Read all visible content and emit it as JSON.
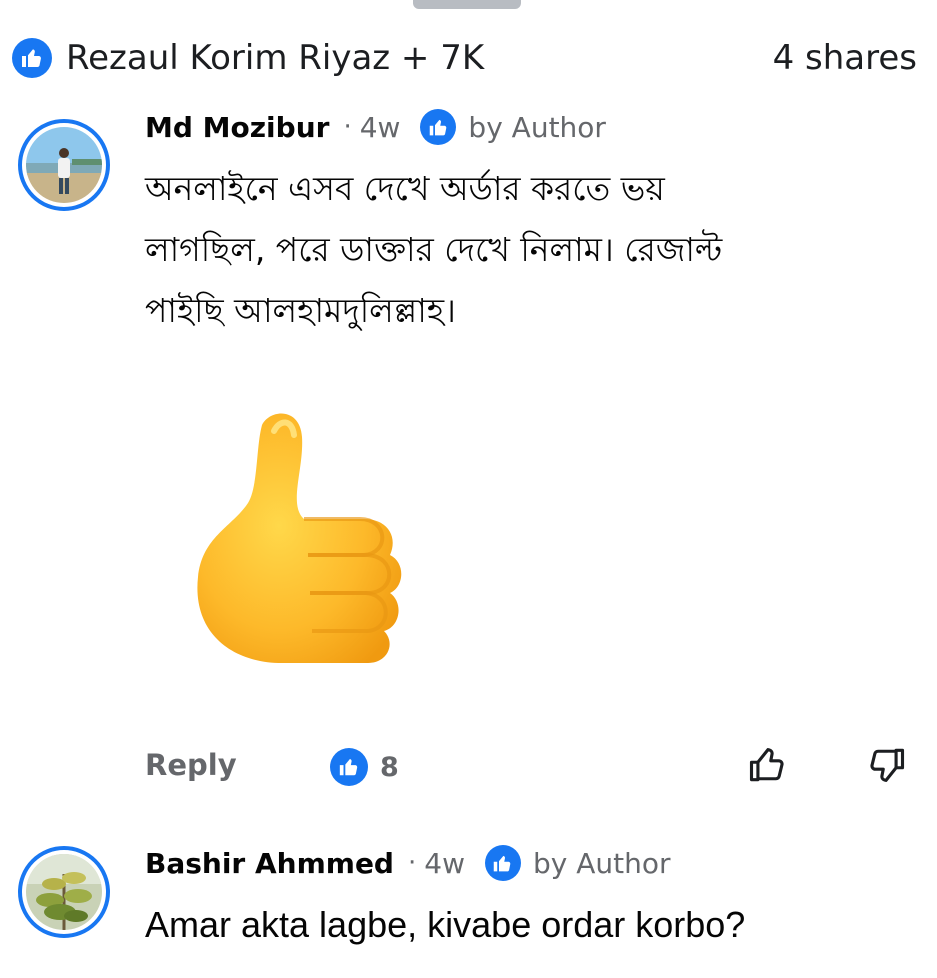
{
  "header": {
    "reactors_text": "Rezaul Korim Riyaz + 7K",
    "shares_text": "4 shares"
  },
  "comments": [
    {
      "author": "Md Mozibur",
      "time": "4w",
      "badge": "by Author",
      "text_lines": [
        "অনলাইনে এসব দেখে অর্ডার করতে ভয়",
        "লাগছিল, পরে ডাক্তার দেখে নিলাম। রেজাল্ট",
        "পাইছি আলহামদুলিল্লাহ।"
      ],
      "sticker": "thumbs-up-emoji",
      "reply_label": "Reply",
      "reaction_count": "8"
    },
    {
      "author": "Bashir Ahmmed",
      "time": "4w",
      "badge": "by Author",
      "text": "Amar akta lagbe, kivabe ordar korbo?"
    }
  ],
  "icons": {
    "reaction": "like-reaction-icon",
    "like_action": "thumbs-up-outline-icon",
    "dislike_action": "thumbs-down-outline-icon"
  },
  "colors": {
    "accent": "#1877f2",
    "secondary_text": "#65676b",
    "primary_text": "#050505"
  }
}
